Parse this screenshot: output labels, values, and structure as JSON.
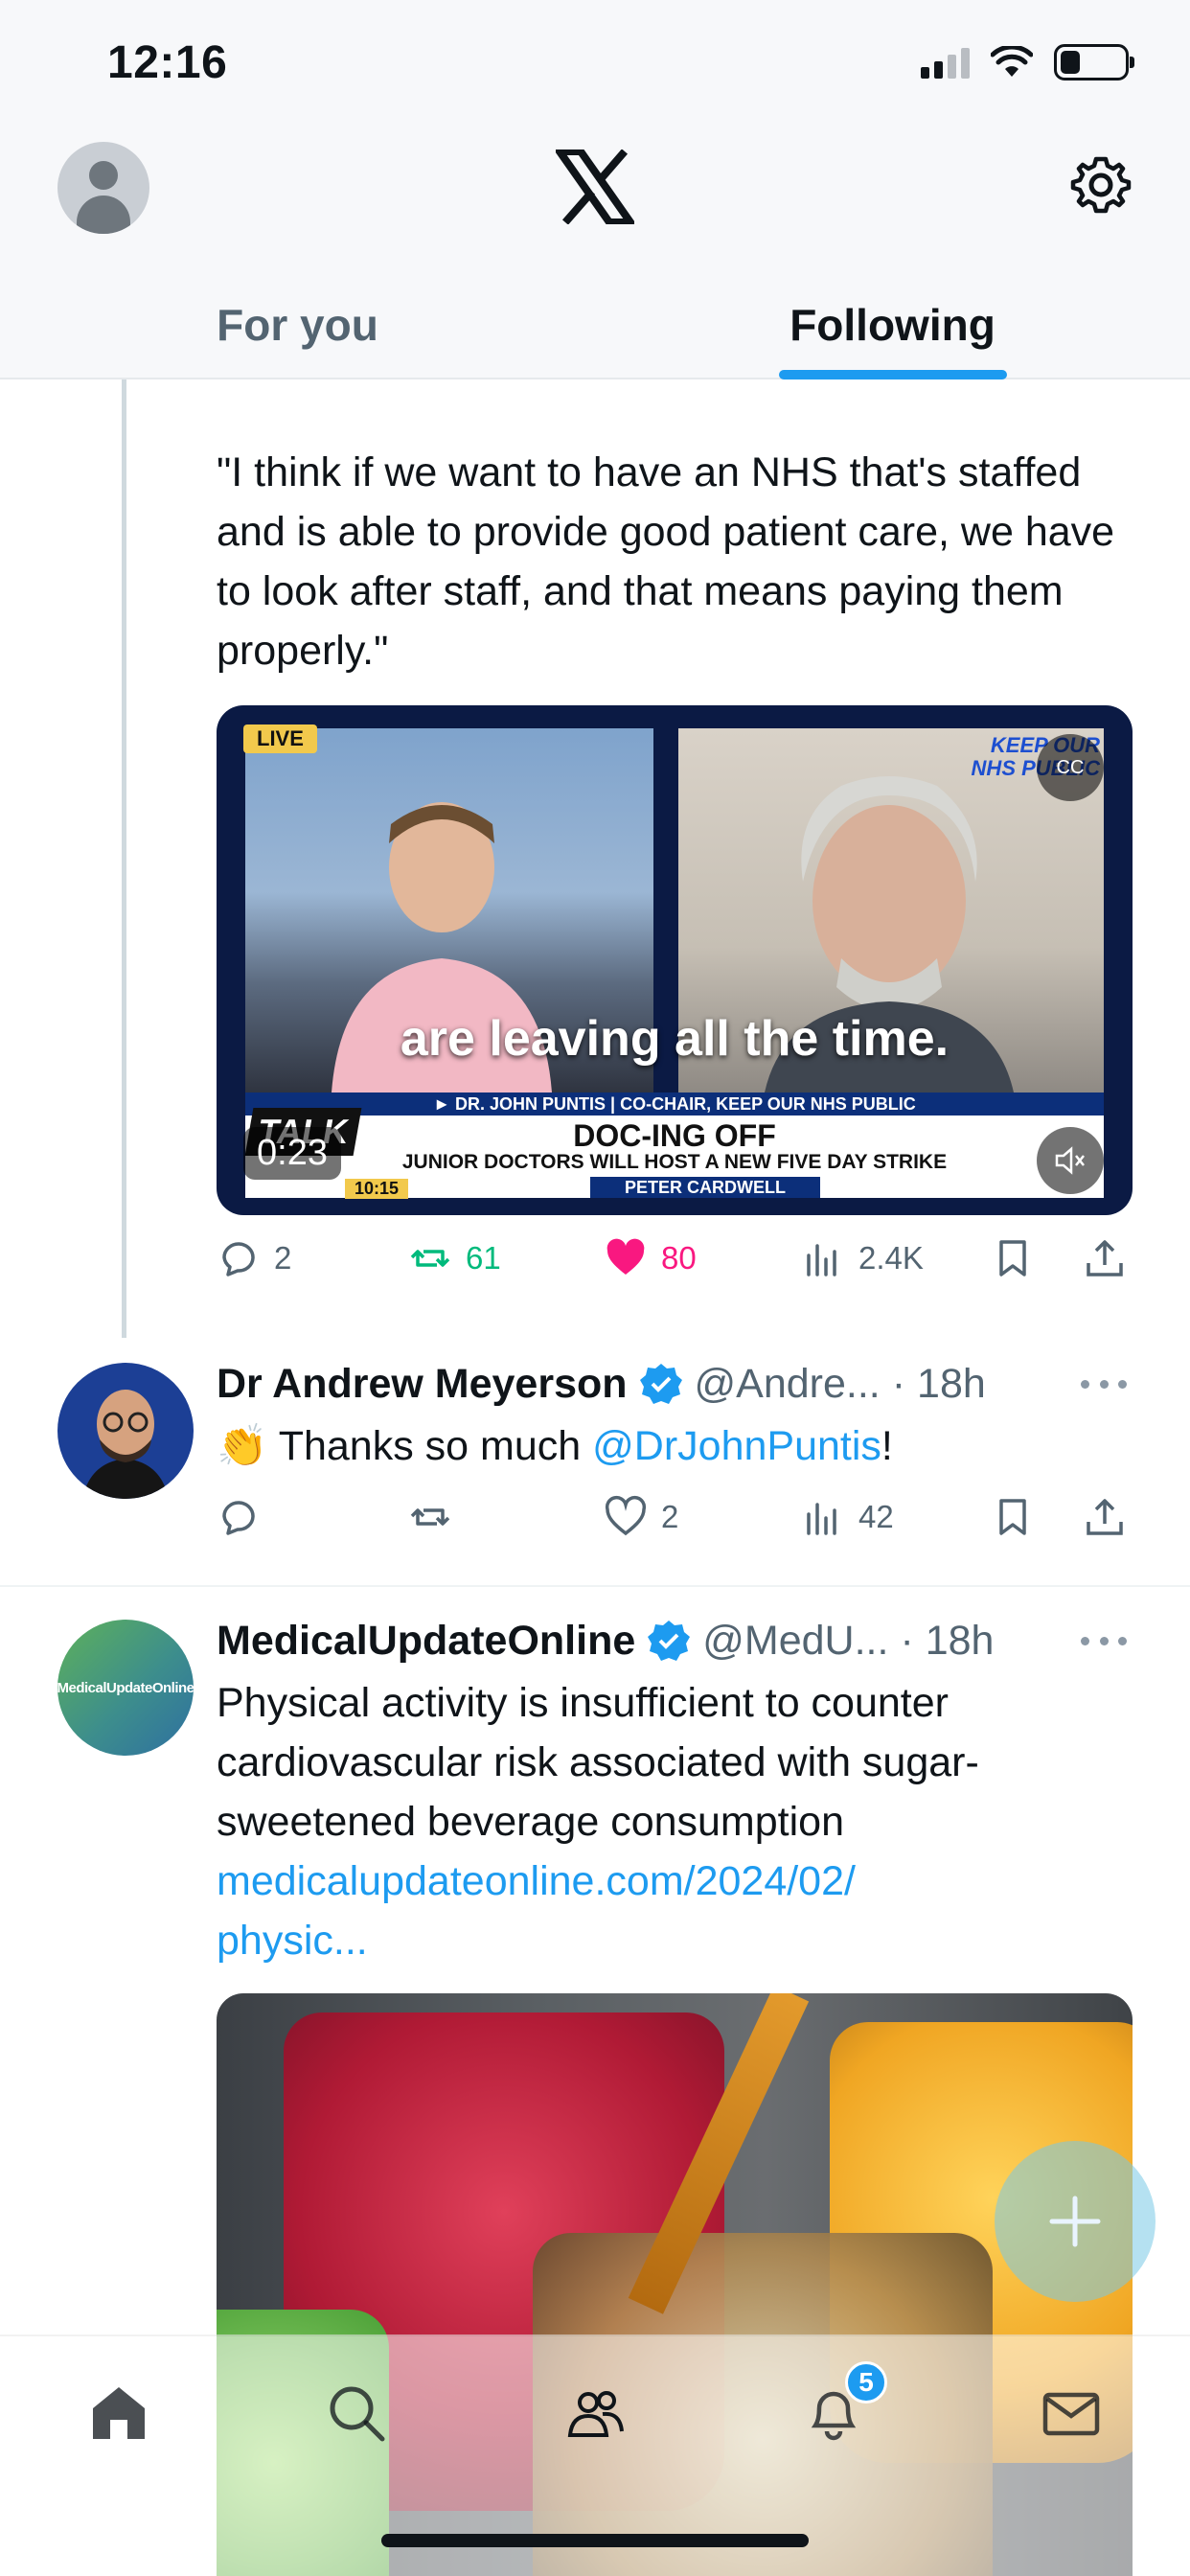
{
  "status_bar": {
    "time": "12:16"
  },
  "header": {
    "tabs": [
      {
        "label": "For you",
        "active": false
      },
      {
        "label": "Following",
        "active": true
      }
    ]
  },
  "tweets": [
    {
      "text": "\"I think if we want to have an NHS that's staffed and is able to provide good patient care, we have to look after staff, and that means paying them properly.\"",
      "video": {
        "duration": "0:23",
        "subtitle": "are leaving all the time.",
        "live_tag": "LIVE",
        "corner_tag": "KEEP OUR NHS PUBLIC",
        "lower_third_top": "► DR. JOHN PUNTIS | CO-CHAIR, KEEP OUR NHS PUBLIC",
        "headline": "DOC-ING OFF",
        "subheadline": "JUNIOR DOCTORS WILL HOST A NEW FIVE DAY STRIKE",
        "presenter": "PETER CARDWELL",
        "channel": "TALK",
        "clock": "10:15"
      },
      "stats": {
        "replies": "2",
        "reposts": "61",
        "likes": "80",
        "views": "2.4K"
      }
    },
    {
      "name": "Dr Andrew Meyerson",
      "handle": "@Andre...",
      "time": "· 18h",
      "emoji": "👏",
      "text_before": " Thanks so much ",
      "mention": "@DrJohnPuntis",
      "text_after": "!",
      "stats": {
        "replies": "",
        "reposts": "",
        "likes": "2",
        "views": "42"
      }
    },
    {
      "name": "MedicalUpdateOnline",
      "handle": "@MedU...",
      "time": "· 18h",
      "avatar_text": "MedicalUpdateOnline",
      "text": "Physical activity is insufficient to counter cardiovascular risk associated with sugar-sweetened beverage consumption",
      "link_line1": "medicalupdateonline.com/2024/02/",
      "link_line2": "physic..."
    }
  ],
  "bottom_nav": {
    "notifications_badge": "5"
  },
  "colors": {
    "accent": "#1d9bf0",
    "repost": "#00ba7c",
    "like": "#f91880",
    "muted": "#536471"
  }
}
